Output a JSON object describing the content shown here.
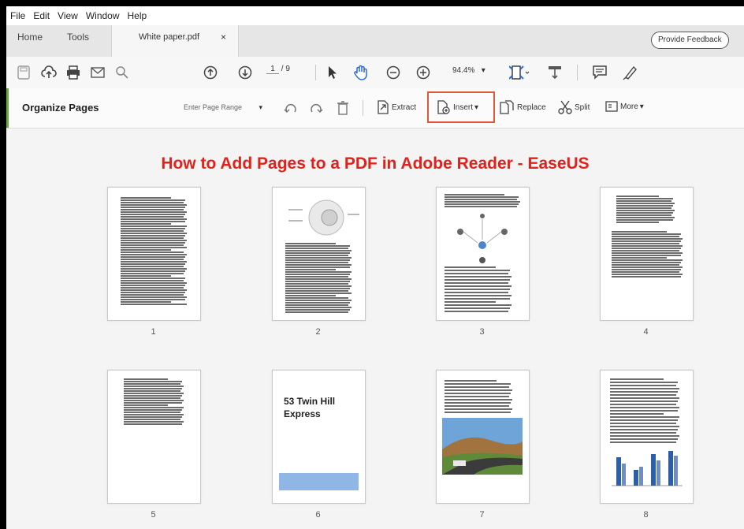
{
  "menu": [
    "File",
    "Edit",
    "View",
    "Window",
    "Help"
  ],
  "tabs": {
    "home": "Home",
    "tools": "Tools",
    "document": "White paper.pdf",
    "close": "×"
  },
  "feedback_label": "Provide Feedback",
  "toolbar": {
    "page_current": "1",
    "page_total": "/ 9",
    "zoom": "94.4%"
  },
  "organize": {
    "title": "Organize Pages",
    "page_range_placeholder": "Enter Page Range",
    "extract": "Extract",
    "insert": "Insert",
    "replace": "Replace",
    "split": "Split",
    "more": "More"
  },
  "headline": "How to Add Pages to a PDF in Adobe Reader - EaseUS",
  "pages": [
    {
      "number": "1"
    },
    {
      "number": "2"
    },
    {
      "number": "3"
    },
    {
      "number": "4"
    },
    {
      "number": "5"
    },
    {
      "number": "6",
      "title_line1": "53 Twin Hill",
      "title_line2": "Express"
    },
    {
      "number": "7"
    },
    {
      "number": "8"
    }
  ],
  "colors": {
    "accent_green": "#6aa846",
    "highlight_red": "#e2563a",
    "headline_red": "#e0221d",
    "link_blue": "#2d6bd6"
  }
}
